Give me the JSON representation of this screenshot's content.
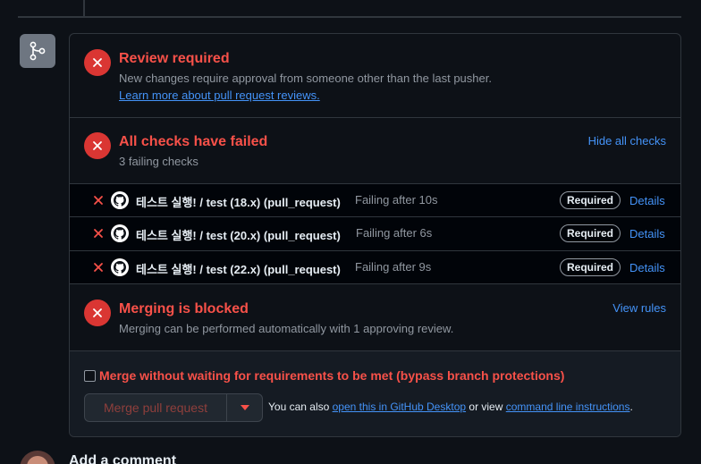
{
  "colors": {
    "danger": "#f85149",
    "danger_circle": "#da3633",
    "link": "#4493f8",
    "muted": "#9198a1",
    "border": "#30363d",
    "background": "#0d1117"
  },
  "icons": {
    "badge": "git-branch-icon",
    "status": "x-circle-icon",
    "check_fail": "x-icon",
    "check_app": "github-logo-icon",
    "dropdown": "triangle-down-icon"
  },
  "review": {
    "title": "Review required",
    "description": "New changes require approval from someone other than the last pusher.",
    "link": "Learn more about pull request reviews."
  },
  "checks": {
    "title": "All checks have failed",
    "summary": "3 failing checks",
    "toggle_label": "Hide all checks",
    "items": [
      {
        "name": "테스트 실행! / test (18.x) (pull_request)",
        "status": "Failing after 10s",
        "badge": "Required",
        "details": "Details"
      },
      {
        "name": "테스트 실행! / test (20.x) (pull_request)",
        "status": "Failing after 6s",
        "badge": "Required",
        "details": "Details"
      },
      {
        "name": "테스트 실행! / test (22.x) (pull_request)",
        "status": "Failing after 9s",
        "badge": "Required",
        "details": "Details"
      }
    ]
  },
  "merging": {
    "title": "Merging is blocked",
    "description": "Merging can be performed automatically with 1 approving review.",
    "rules_link": "View rules"
  },
  "merge_box": {
    "bypass_label": "Merge without waiting for requirements to be met (bypass branch protections)",
    "bypass_checked": false,
    "merge_button": "Merge pull request",
    "also_prefix": "You can also",
    "desktop_link": "open this in GitHub Desktop",
    "or_view": "or view",
    "cli_link": "command line instructions",
    "suffix": "."
  },
  "comment": {
    "heading": "Add a comment"
  }
}
